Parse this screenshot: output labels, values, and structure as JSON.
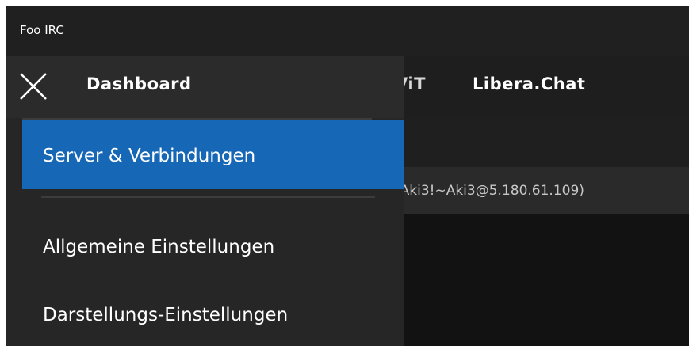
{
  "window": {
    "title": "Foo IRC"
  },
  "tabs": [
    {
      "label": "ViT"
    },
    {
      "label": "Libera.Chat"
    }
  ],
  "user_line": "(Aki3!~Aki3@5.180.61.109)",
  "menu": {
    "title": "Dashboard",
    "items": [
      {
        "label": "Server & Verbindungen",
        "selected": true
      },
      {
        "label": "Allgemeine Einstellungen",
        "selected": false
      },
      {
        "label": "Darstellungs-Einstellungen",
        "selected": false
      }
    ]
  },
  "colors": {
    "accent": "#1767b7",
    "menu_bg": "#262626",
    "titlebar_bg": "#202020"
  }
}
